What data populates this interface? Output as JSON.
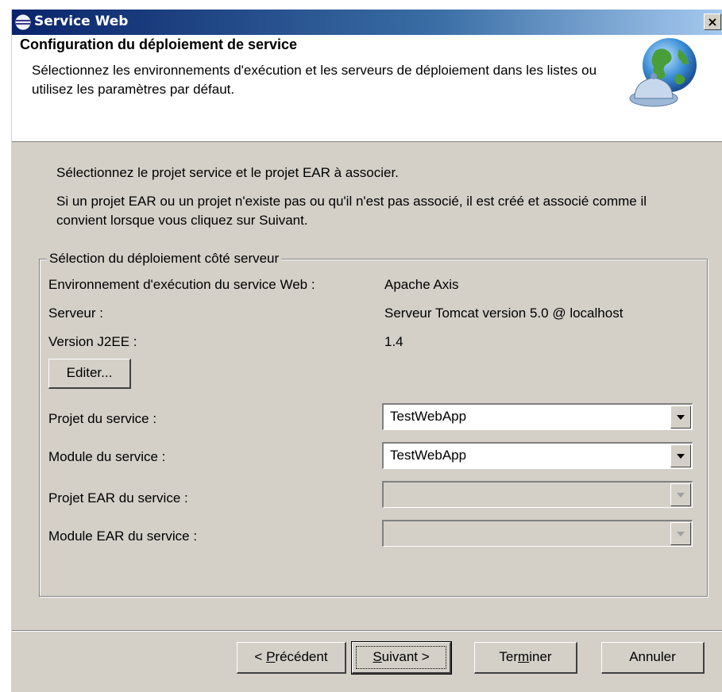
{
  "window": {
    "title": "Service Web",
    "close_glyph": "×"
  },
  "header": {
    "title": "Configuration du déploiement de service",
    "description": "Sélectionnez les environnements d'exécution et les serveurs de déploiement dans les listes ou utilisez les paramètres par défaut."
  },
  "intro": {
    "line1": "Sélectionnez le projet service et le projet EAR à associer.",
    "line2": "Si un projet EAR ou un projet n'existe pas ou qu'il n'est pas associé, il est créé et associé comme il convient lorsque vous cliquez sur Suivant."
  },
  "group": {
    "legend": "Sélection du déploiement côté serveur",
    "runtime_label": "Environnement d'exécution du service Web :",
    "runtime_value": "Apache Axis",
    "server_label": "Serveur :",
    "server_value": "Serveur Tomcat version 5.0 @ localhost",
    "j2ee_label": "Version J2EE :",
    "j2ee_value": "1.4",
    "edit_button": "Editer...",
    "service_project_label": "Projet du service :",
    "service_project_value": "TestWebApp",
    "service_module_label": "Module du service :",
    "service_module_value": "TestWebApp",
    "ear_project_label": "Projet EAR du service :",
    "ear_project_value": "",
    "ear_module_label": "Module EAR du service :",
    "ear_module_value": ""
  },
  "buttons": {
    "back_pre": "< ",
    "back_mnemonic": "P",
    "back_post": "récédent",
    "next_mnemonic": "S",
    "next_post": "uivant >",
    "finish_pre": "Ter",
    "finish_mnemonic": "m",
    "finish_post": "iner",
    "cancel": "Annuler"
  },
  "icons": {
    "title": "eclipse-icon",
    "header": "web-service-globe-icon",
    "combo_arrow": "chevron-down-icon"
  },
  "colors": {
    "titlebar_start": "#0a246a",
    "titlebar_end": "#a6caf0",
    "dialog_bg": "#d4d0c8"
  }
}
